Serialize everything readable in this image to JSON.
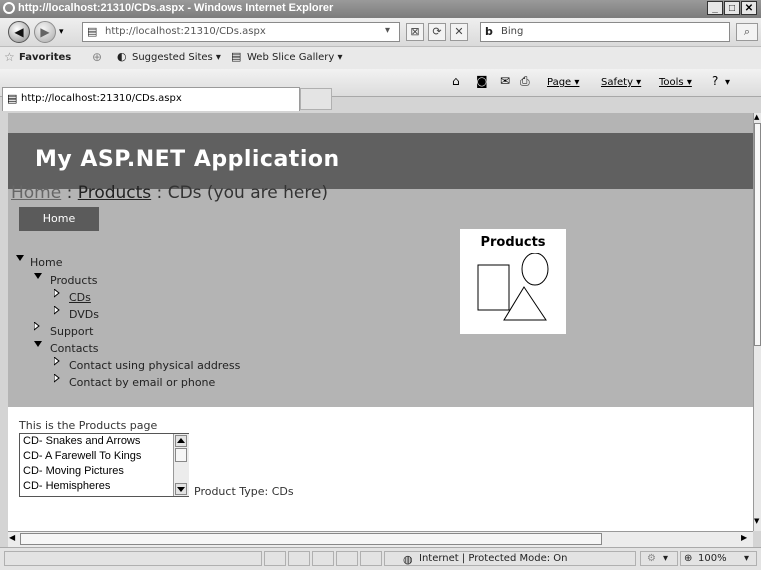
{
  "window": {
    "title": "http://localhost:21310/CDs.aspx - Windows Internet Explorer"
  },
  "address_bar": {
    "url": "http://localhost:21310/CDs.aspx",
    "search_placeholder": "Bing"
  },
  "favorites_bar": {
    "favorites_label": "Favorites",
    "suggested_sites": "Suggested Sites ▾",
    "web_slice_gallery": "Web Slice Gallery ▾"
  },
  "tab": {
    "title": "http://localhost:21310/CDs.aspx"
  },
  "command_bar": {
    "page": "Page ▾",
    "safety": "Safety ▾",
    "tools": "Tools ▾"
  },
  "page": {
    "app_title": "My ASP.NET Application",
    "breadcrumb": {
      "home": "Home",
      "sep1": " : ",
      "products": "Products",
      "sep2": " : ",
      "current": "CDs (you are here)"
    },
    "menu_button": "Home",
    "tree": [
      {
        "label": "Home",
        "expanded": true,
        "level": 0
      },
      {
        "label": "Products",
        "expanded": true,
        "level": 1
      },
      {
        "label": "CDs",
        "level": 2,
        "selected": true
      },
      {
        "label": "DVDs",
        "level": 2
      },
      {
        "label": "Support",
        "level": 1
      },
      {
        "label": "Contacts",
        "expanded": true,
        "level": 1
      },
      {
        "label": "Contact using physical address",
        "level": 2
      },
      {
        "label": "Contact by email or phone",
        "level": 2
      }
    ],
    "image_title": "Products",
    "page_text": "This is the Products page",
    "product_list": [
      "CD- Snakes and Arrows",
      "CD- A Farewell To Kings",
      "CD- Moving Pictures",
      "CD- Hemispheres"
    ],
    "product_type": "Product Type: CDs"
  },
  "status_bar": {
    "zone": "Internet | Protected Mode: On",
    "zoom": "100%"
  },
  "colors": {
    "banner": "#606060",
    "page_bg": "#b4b4b4",
    "menu_button": "#5b5b5b"
  }
}
